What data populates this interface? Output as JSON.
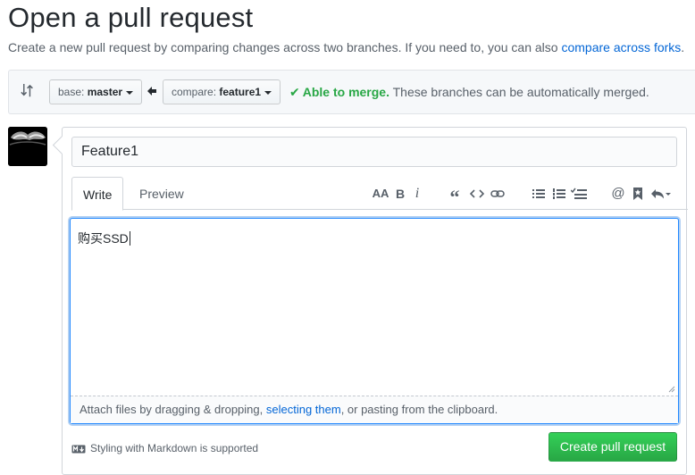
{
  "header": {
    "title": "Open a pull request",
    "description": "Create a new pull request by comparing changes across two branches. If you need to, you can also ",
    "compare_link": "compare across forks",
    "description_end": "."
  },
  "range": {
    "base_prefix": "base:",
    "base_branch": "master",
    "compare_prefix": "compare:",
    "compare_branch": "feature1",
    "merge_status": "Able to merge.",
    "merge_message": " These branches can be automatically merged."
  },
  "form": {
    "title_value": "Feature1",
    "tabs": [
      {
        "label": "Write"
      },
      {
        "label": "Preview"
      }
    ],
    "body_text": "购买SSD",
    "drop_text_1": "Attach files by dragging & dropping, ",
    "drop_link": "selecting them",
    "drop_text_2": ", or pasting from the clipboard.",
    "markdown_note": "Styling with Markdown is supported",
    "submit_label": "Create pull request"
  },
  "toolbar_icons": [
    "header-icon",
    "bold-icon",
    "italic-icon",
    "quote-icon",
    "code-icon",
    "link-icon",
    "unordered-list-icon",
    "ordered-list-icon",
    "task-list-icon",
    "mention-icon",
    "reference-icon",
    "reply-icon"
  ],
  "colors": {
    "accent": "#0366d6",
    "success": "#28a745",
    "focus": "#2188ff"
  }
}
